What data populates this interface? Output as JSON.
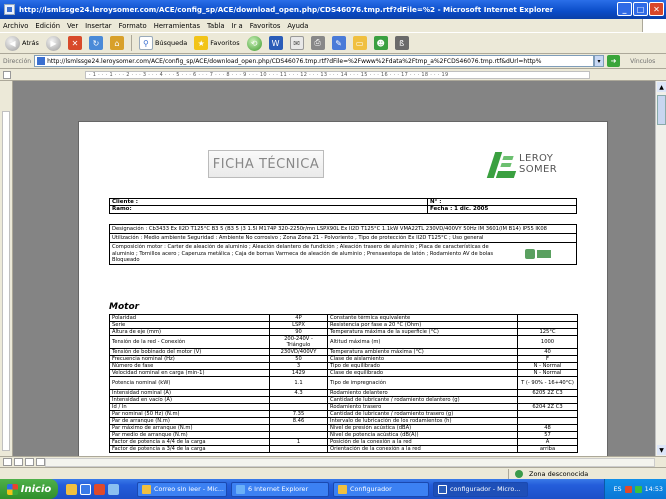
{
  "window": {
    "title": "http://lsmlssge24.leroysomer.com/ACE/config_sp/ACE/download_open.php/CDS46076.tmp.rtf?dFile=%2 - Microsoft Internet Explorer"
  },
  "menu": [
    "Archivo",
    "Edición",
    "Ver",
    "Insertar",
    "Formato",
    "Herramientas",
    "Tabla",
    "Ir a",
    "Favoritos",
    "Ayuda"
  ],
  "toolbar": {
    "back_label": "Atrás",
    "search_label": "Búsqueda",
    "favorites_label": "Favoritos"
  },
  "address": {
    "label": "Dirección",
    "url": "http://lsmlssge24.leroysomer.com/ACE/config_sp/ACE/download_open.php/CDS46076.tmp.rtf?dFile=%2Fwww%2Fdata%2Ftmp_a%2FCDS46076.tmp.rtf&dUrl=http%",
    "links_label": "Vínculos"
  },
  "ruler": {
    "text": "· 1 · · · 1 · · · 2 · · · 3 · · · 4 · · · 5 · · · 6 · · · 7 · · · 8 · · · 9 · · · 10 · · · 11 · · · 12 · · · 13 · · · 14 · · · 15 · · · 16 · · · 17 · · · 18 · · · 19"
  },
  "document": {
    "ficha_title": "FICHA TÉCNICA",
    "logo_line1": "LEROY",
    "logo_line2": "SOMER",
    "cliente_label": "Cliente :",
    "ramo_label": "Ramo:",
    "n_label": "N° :",
    "fecha": "Fecha : 1 dic. 2005",
    "designacion": "Designación : Cb3433 Ex II2D T125°C B3 5 (B3 5 )3 1.5I M174P 320-2250r/mn LSPX90L Ex II2D T125°C 1.1kW VMA22TL 230VD/400VY 50Hz IM 3601(IM B14) IP55 IK08",
    "utilizacion": "Utilización : Medio ambiente Seguridad : Ambiente No corrosivo ; Zona Zona 21 - Polvoriento , Tipo de protección Ex II2D T125°C ; Uso general",
    "composicion": "Composición motor : Carter de aleación de aluminio ; Aleación delantero de fundición ; Aleación trasero de aluminio ; Placa de características de aluminio ; Tornillos acero ; Caperuza metálica ; Caja de bornas Varmeca de aleación de aluminio ; Prensaestopa de latón ; Rodamiento AV de bolas Bloqueado",
    "motor_heading": "Motor"
  },
  "spec_rows": [
    [
      "Polaridad",
      "4P",
      "Constante térmica equivalente",
      ""
    ],
    [
      "Serie",
      "LSPX",
      "Resistencia por fase a 20 °C (Ohm)",
      ""
    ],
    [
      "Altura de eje (mm)",
      "90",
      "Temperatura máxima de la superficie (°C)",
      "125°C"
    ],
    [
      "Tensión de la red - Conexión",
      "200-240V - Triángulo",
      "Altitud máxima (m)",
      "1000"
    ],
    [
      "Tensión de bobinado del motor (V)",
      "230VD/400VY",
      "Temperatura ambiente máxima (°C)",
      "40"
    ],
    [
      "Frecuencia nominal (Hz)",
      "50",
      "Clase de aislamiento",
      "F"
    ],
    [
      "Número de fase",
      "3",
      "Tipo de equilibrado",
      "N - Normal"
    ],
    [
      "Velocidad nominal en carga (min-1)",
      "1429",
      "Clase de equilibrado",
      "N - Normal"
    ],
    [
      "Potencia nominal (kW)",
      "1.1",
      "Tipo de impregnación",
      "T (- 90% - 16+40°C)"
    ],
    [
      "Intensidad nominal (A)",
      "4.3",
      "Rodamiento delantero",
      "6205 2Z C3"
    ],
    [
      "Intensidad en vacío (A)",
      "",
      "Cantidad de lubricante / rodamiento delantero (g)",
      ""
    ],
    [
      "Id / In",
      "",
      "Rodamiento trasero",
      "6204 2Z C3"
    ],
    [
      "Par nominal (50 Hz) (N.m)",
      "7.35",
      "Cantidad de lubricante / rodamiento trasero (g)",
      ""
    ],
    [
      "Par de arranque (N.m)",
      "8.46",
      "Intervalo de lubricación de los rodamientos (h)",
      ""
    ],
    [
      "Par máximo de arranque (N.m)",
      "",
      "Nivel de presión acústica (dBA)",
      "48"
    ],
    [
      "Par medio de arranque (N.m)",
      "",
      "Nivel de potencia acústica (dB(A))",
      "57"
    ],
    [
      "Factor de potencia a 4/4 de la carga",
      "1",
      "Posición de la conexión a la red",
      "A"
    ],
    [
      "Factor de potencia a 3/4 de la carga",
      "",
      "Orientación de la conexión a la red",
      "arriba"
    ]
  ],
  "status": {
    "zone": "Zona desconocida"
  },
  "taskbar": {
    "start_label": "Inicio",
    "tasks": [
      "Correo sin leer - Mic...",
      "6 Internet Explorer",
      "Configurador",
      "configurador - Micro..."
    ],
    "clock": "14:53",
    "lang": "ES"
  },
  "colors": {
    "title_blue": "#0a4cc8",
    "leroy_green": "#3aa040",
    "start_green": "#3a9a35"
  }
}
